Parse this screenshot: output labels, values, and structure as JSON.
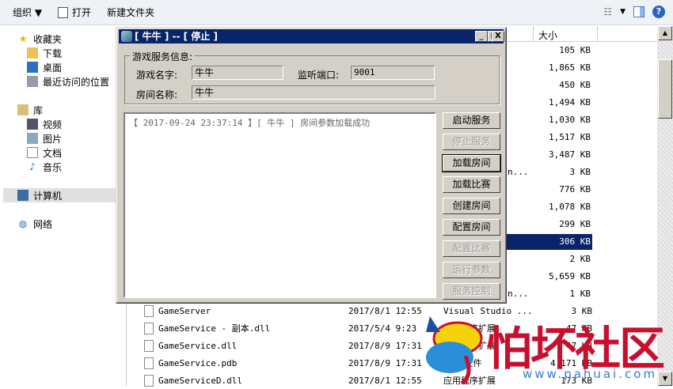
{
  "toolbar": {
    "organize": "组织 ▼",
    "open": "打开",
    "new_folder": "新建文件夹"
  },
  "sidebar": {
    "favorites": "收藏夹",
    "downloads": "下载",
    "desktop": "桌面",
    "recent": "最近访问的位置",
    "libraries": "库",
    "videos": "视频",
    "pictures": "图片",
    "documents": "文档",
    "music": "音乐",
    "computer": "计算机",
    "network": "网络"
  },
  "list": {
    "size_header": "大小",
    "sizes": [
      "105 KB",
      "1,865 KB",
      "450 KB",
      "1,494 KB",
      "1,030 KB",
      "1,517 KB",
      "3,487 KB",
      "3 KB",
      "776 KB",
      "1,078 KB",
      "299 KB",
      "306 KB",
      "2 KB",
      "5,659 KB",
      "1 KB"
    ],
    "trunc": {
      "t8": "n...",
      "t15": "n..."
    },
    "files": [
      {
        "name": "GameServer",
        "date": "2017/8/1 12:55",
        "type": "Visual Studio ...",
        "size": "3 KB"
      },
      {
        "name": "GameService - 副本.dll",
        "date": "2017/5/4 9:23",
        "type": "应用程序扩展",
        "size": "47 KB"
      },
      {
        "name": "GameService.dll",
        "date": "2017/8/9 17:31",
        "type": "应用程序扩展",
        "size": "47 KB"
      },
      {
        "name": "GameService.pdb",
        "date": "2017/8/9 17:31",
        "type": "PDB 文件",
        "size": "4,171 KB"
      },
      {
        "name": "GameServiceD.dll",
        "date": "2017/8/1 12:55",
        "type": "应用程序扩展",
        "size": "173 KB"
      }
    ]
  },
  "dialog": {
    "title": "[ 牛牛 ] -- [ 停止 ]",
    "group": "游戏服务信息:",
    "game_name_label": "游戏名字:",
    "game_name": "牛牛",
    "port_label": "监听端口:",
    "port": "9001",
    "room_label": "房间名称:",
    "room": "牛牛",
    "log": "【 2017-09-24 23:37:14 】[ 牛牛 ] 房间参数加载成功",
    "buttons": [
      "启动服务",
      "停止服务",
      "加载房间",
      "加载比赛",
      "创建房间",
      "配置房间",
      "配置比赛",
      "运行参数",
      "服务控制"
    ]
  },
  "watermark": {
    "text": "怕坏社区",
    "url": "www.pahuai.com"
  }
}
